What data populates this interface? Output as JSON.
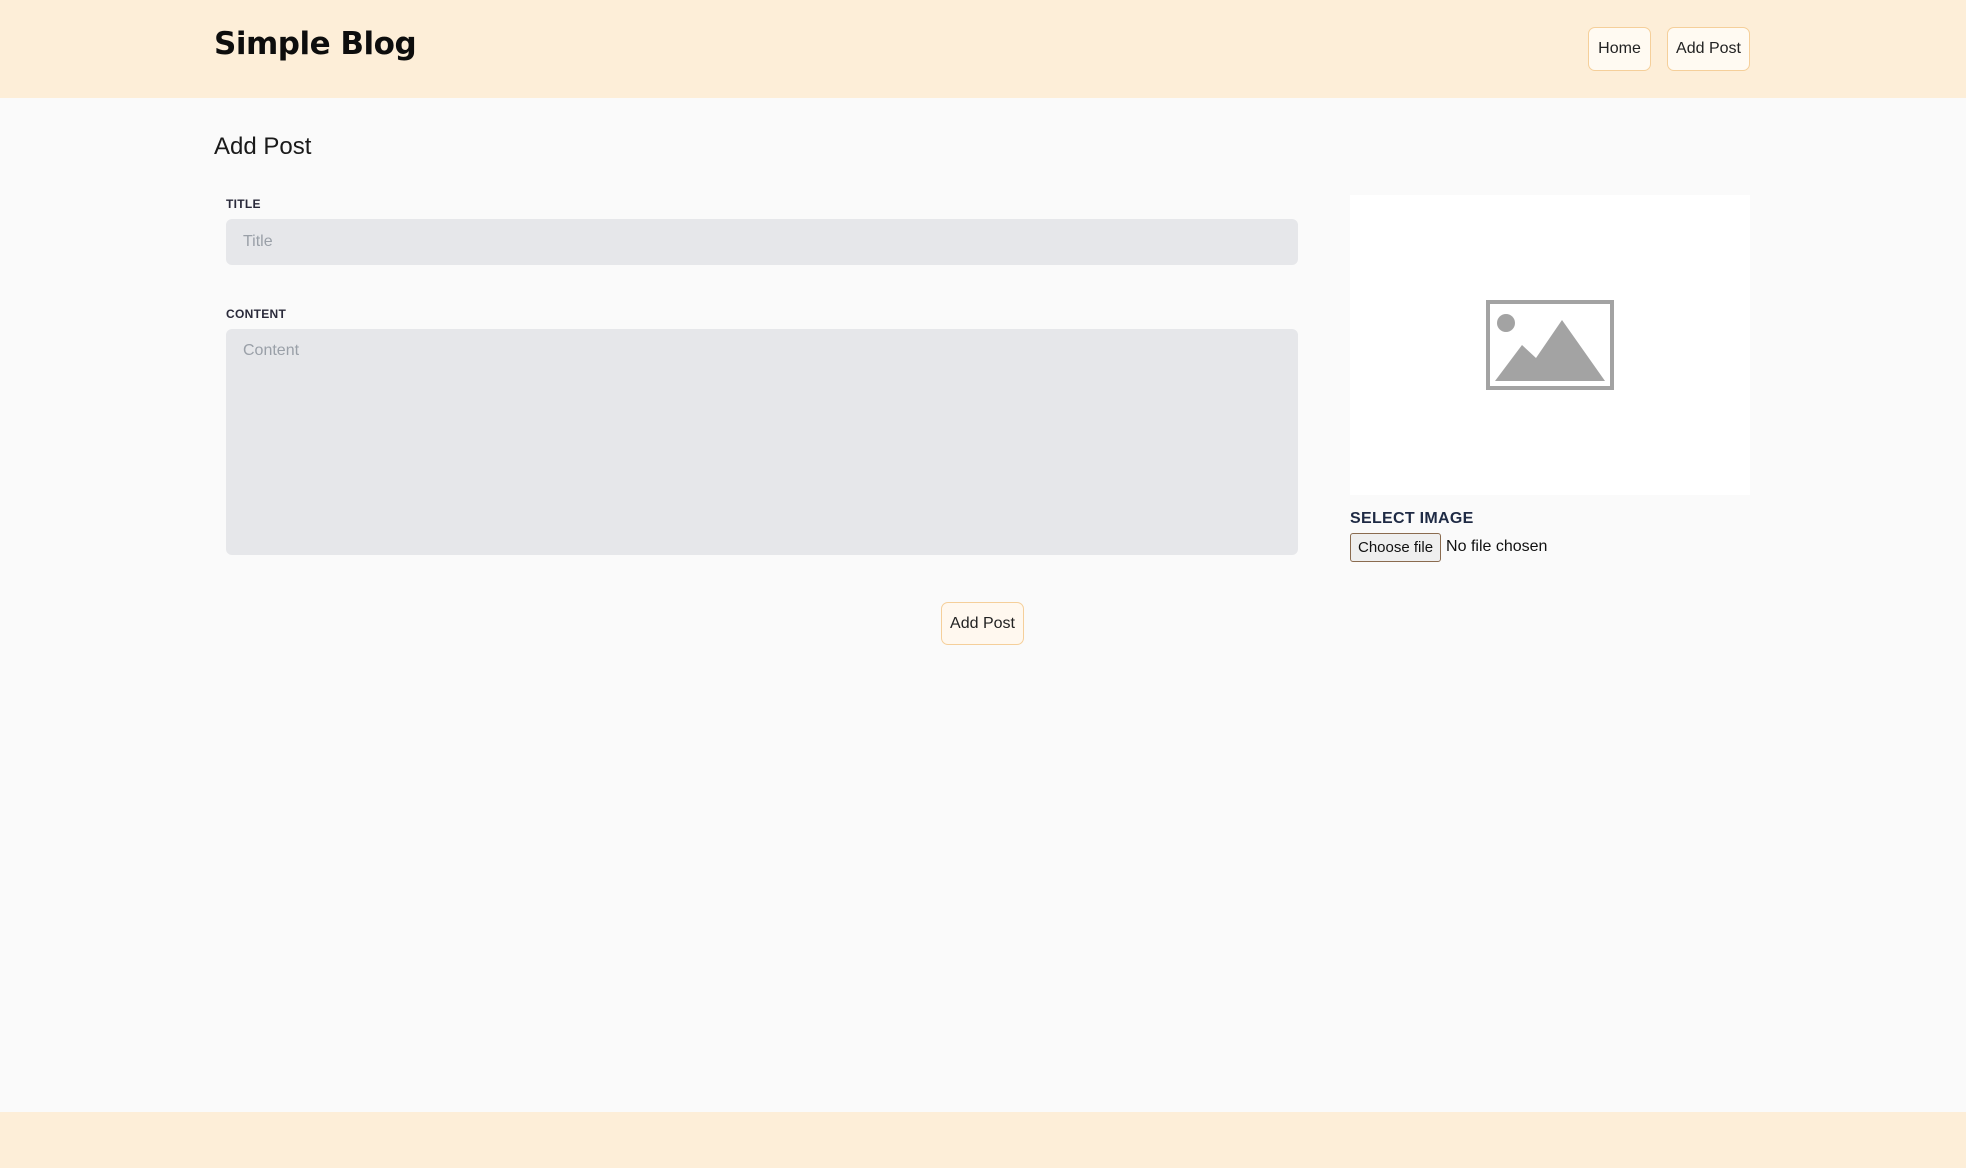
{
  "header": {
    "brand": "Simple Blog",
    "nav": [
      {
        "label": "Home"
      },
      {
        "label": "Add Post"
      }
    ]
  },
  "main": {
    "title": "Add Post",
    "form": {
      "title_label": "TITLE",
      "title_placeholder": "Title",
      "title_value": "",
      "content_label": "CONTENT",
      "content_placeholder": "Content",
      "content_value": "",
      "submit_label": "Add Post"
    },
    "image": {
      "placeholder_icon": "image-placeholder-icon",
      "select_label": "SELECT IMAGE",
      "choose_button": "Choose file",
      "file_status": "No file chosen"
    }
  },
  "colors": {
    "header_bg": "#fdeed8",
    "button_border": "#f5cf9a",
    "input_bg": "#e6e7ea",
    "page_bg": "#fafafa"
  }
}
